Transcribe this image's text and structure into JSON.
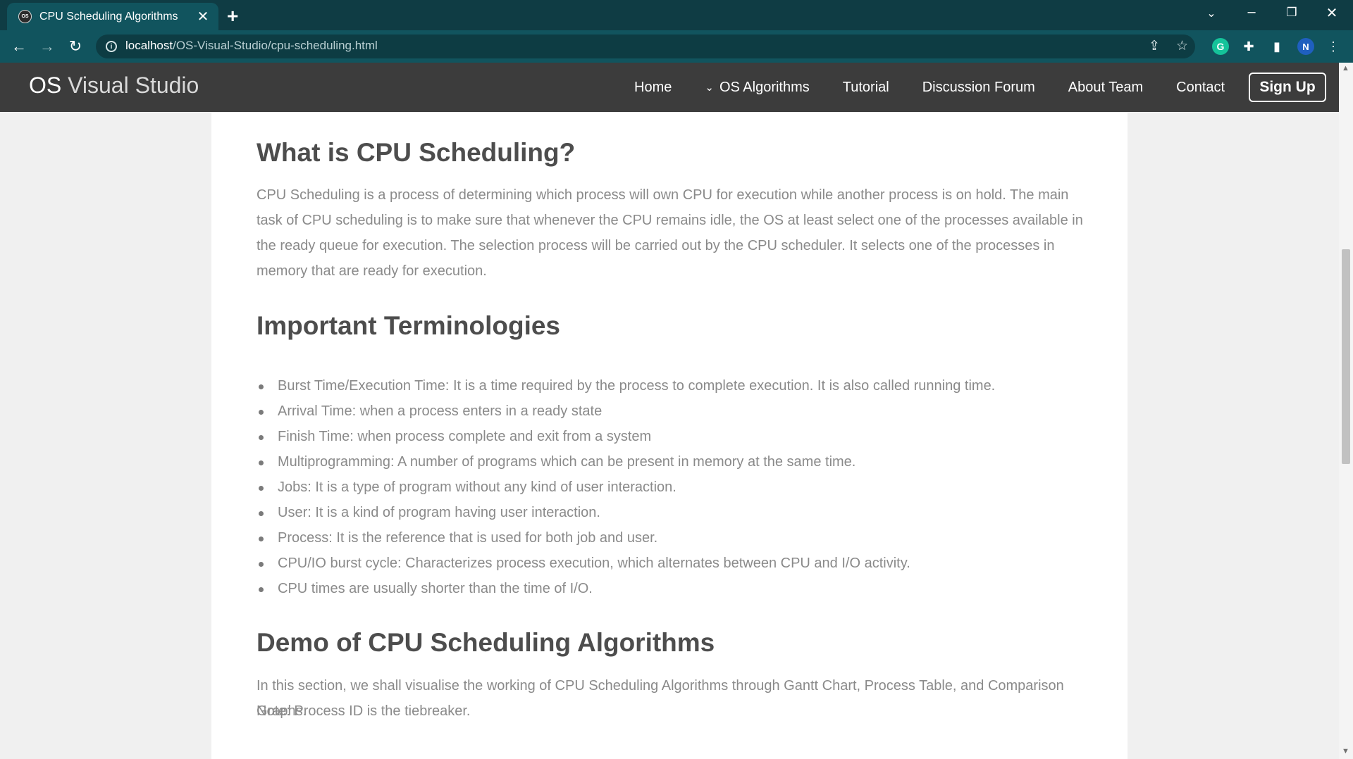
{
  "browser": {
    "tab_title": "CPU Scheduling Algorithms",
    "favicon_text": "OS",
    "url_host": "localhost",
    "url_path": "/OS-Visual-Studio/cpu-scheduling.html",
    "profile_initial": "N",
    "grammarly_letter": "G"
  },
  "navbar": {
    "brand_bold": "OS",
    "brand_rest": " Visual Studio",
    "links": [
      "Home",
      "OS Algorithms",
      "Tutorial",
      "Discussion Forum",
      "About Team",
      "Contact"
    ],
    "signup": "Sign Up"
  },
  "sections": {
    "what": {
      "heading": "What is CPU Scheduling?",
      "body": "CPU Scheduling is a process of determining which process will own CPU for execution while another process is on hold. The main task of CPU scheduling is to make sure that whenever the CPU remains idle, the OS at least select one of the processes available in the ready queue for execution. The selection process will be carried out by the CPU scheduler. It selects one of the processes in memory that are ready for execution."
    },
    "terms": {
      "heading": "Important Terminologies",
      "items": [
        "Burst Time/Execution Time: It is a time required by the process to complete execution. It is also called running time.",
        "Arrival Time: when a process enters in a ready state",
        "Finish Time: when process complete and exit from a system",
        "Multiprogramming: A number of programs which can be present in memory at the same time.",
        "Jobs: It is a type of program without any kind of user interaction.",
        "User: It is a kind of program having user interaction.",
        "Process: It is the reference that is used for both job and user.",
        "CPU/IO burst cycle: Characterizes process execution, which alternates between CPU and I/O activity.",
        "CPU times are usually shorter than the time of I/O."
      ]
    },
    "demo": {
      "heading": "Demo of CPU Scheduling Algorithms",
      "body": "In this section, we shall visualise the working of CPU Scheduling Algorithms through Gantt Chart, Process Table, and Comparison Graphs.",
      "note": "Note: Process ID is the tiebreaker."
    }
  }
}
